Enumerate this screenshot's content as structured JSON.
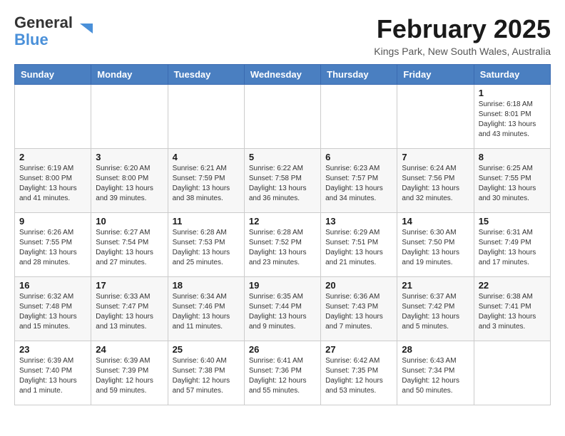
{
  "header": {
    "logo_general": "General",
    "logo_blue": "Blue",
    "month_year": "February 2025",
    "location": "Kings Park, New South Wales, Australia"
  },
  "weekdays": [
    "Sunday",
    "Monday",
    "Tuesday",
    "Wednesday",
    "Thursday",
    "Friday",
    "Saturday"
  ],
  "weeks": [
    [
      {
        "day": "",
        "info": ""
      },
      {
        "day": "",
        "info": ""
      },
      {
        "day": "",
        "info": ""
      },
      {
        "day": "",
        "info": ""
      },
      {
        "day": "",
        "info": ""
      },
      {
        "day": "",
        "info": ""
      },
      {
        "day": "1",
        "info": "Sunrise: 6:18 AM\nSunset: 8:01 PM\nDaylight: 13 hours\nand 43 minutes."
      }
    ],
    [
      {
        "day": "2",
        "info": "Sunrise: 6:19 AM\nSunset: 8:00 PM\nDaylight: 13 hours\nand 41 minutes."
      },
      {
        "day": "3",
        "info": "Sunrise: 6:20 AM\nSunset: 8:00 PM\nDaylight: 13 hours\nand 39 minutes."
      },
      {
        "day": "4",
        "info": "Sunrise: 6:21 AM\nSunset: 7:59 PM\nDaylight: 13 hours\nand 38 minutes."
      },
      {
        "day": "5",
        "info": "Sunrise: 6:22 AM\nSunset: 7:58 PM\nDaylight: 13 hours\nand 36 minutes."
      },
      {
        "day": "6",
        "info": "Sunrise: 6:23 AM\nSunset: 7:57 PM\nDaylight: 13 hours\nand 34 minutes."
      },
      {
        "day": "7",
        "info": "Sunrise: 6:24 AM\nSunset: 7:56 PM\nDaylight: 13 hours\nand 32 minutes."
      },
      {
        "day": "8",
        "info": "Sunrise: 6:25 AM\nSunset: 7:55 PM\nDaylight: 13 hours\nand 30 minutes."
      }
    ],
    [
      {
        "day": "9",
        "info": "Sunrise: 6:26 AM\nSunset: 7:55 PM\nDaylight: 13 hours\nand 28 minutes."
      },
      {
        "day": "10",
        "info": "Sunrise: 6:27 AM\nSunset: 7:54 PM\nDaylight: 13 hours\nand 27 minutes."
      },
      {
        "day": "11",
        "info": "Sunrise: 6:28 AM\nSunset: 7:53 PM\nDaylight: 13 hours\nand 25 minutes."
      },
      {
        "day": "12",
        "info": "Sunrise: 6:28 AM\nSunset: 7:52 PM\nDaylight: 13 hours\nand 23 minutes."
      },
      {
        "day": "13",
        "info": "Sunrise: 6:29 AM\nSunset: 7:51 PM\nDaylight: 13 hours\nand 21 minutes."
      },
      {
        "day": "14",
        "info": "Sunrise: 6:30 AM\nSunset: 7:50 PM\nDaylight: 13 hours\nand 19 minutes."
      },
      {
        "day": "15",
        "info": "Sunrise: 6:31 AM\nSunset: 7:49 PM\nDaylight: 13 hours\nand 17 minutes."
      }
    ],
    [
      {
        "day": "16",
        "info": "Sunrise: 6:32 AM\nSunset: 7:48 PM\nDaylight: 13 hours\nand 15 minutes."
      },
      {
        "day": "17",
        "info": "Sunrise: 6:33 AM\nSunset: 7:47 PM\nDaylight: 13 hours\nand 13 minutes."
      },
      {
        "day": "18",
        "info": "Sunrise: 6:34 AM\nSunset: 7:46 PM\nDaylight: 13 hours\nand 11 minutes."
      },
      {
        "day": "19",
        "info": "Sunrise: 6:35 AM\nSunset: 7:44 PM\nDaylight: 13 hours\nand 9 minutes."
      },
      {
        "day": "20",
        "info": "Sunrise: 6:36 AM\nSunset: 7:43 PM\nDaylight: 13 hours\nand 7 minutes."
      },
      {
        "day": "21",
        "info": "Sunrise: 6:37 AM\nSunset: 7:42 PM\nDaylight: 13 hours\nand 5 minutes."
      },
      {
        "day": "22",
        "info": "Sunrise: 6:38 AM\nSunset: 7:41 PM\nDaylight: 13 hours\nand 3 minutes."
      }
    ],
    [
      {
        "day": "23",
        "info": "Sunrise: 6:39 AM\nSunset: 7:40 PM\nDaylight: 13 hours\nand 1 minute."
      },
      {
        "day": "24",
        "info": "Sunrise: 6:39 AM\nSunset: 7:39 PM\nDaylight: 12 hours\nand 59 minutes."
      },
      {
        "day": "25",
        "info": "Sunrise: 6:40 AM\nSunset: 7:38 PM\nDaylight: 12 hours\nand 57 minutes."
      },
      {
        "day": "26",
        "info": "Sunrise: 6:41 AM\nSunset: 7:36 PM\nDaylight: 12 hours\nand 55 minutes."
      },
      {
        "day": "27",
        "info": "Sunrise: 6:42 AM\nSunset: 7:35 PM\nDaylight: 12 hours\nand 53 minutes."
      },
      {
        "day": "28",
        "info": "Sunrise: 6:43 AM\nSunset: 7:34 PM\nDaylight: 12 hours\nand 50 minutes."
      },
      {
        "day": "",
        "info": ""
      }
    ]
  ]
}
